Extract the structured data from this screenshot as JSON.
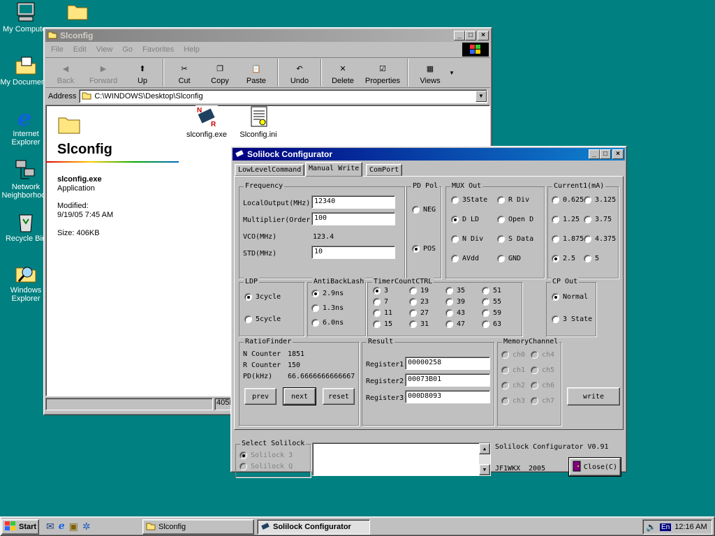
{
  "desktop": {
    "icons": [
      "My Computer",
      "",
      "My Documents",
      "Internet Explorer",
      "Network Neighborhood",
      "Recycle Bin",
      "Windows Explorer"
    ]
  },
  "explorer": {
    "title": "Slconfig",
    "menu": [
      "File",
      "Edit",
      "View",
      "Go",
      "Favorites",
      "Help"
    ],
    "toolbar": [
      "Back",
      "Forward",
      "Up",
      "Cut",
      "Copy",
      "Paste",
      "Undo",
      "Delete",
      "Properties",
      "Views"
    ],
    "address_label": "Address",
    "address_value": "C:\\WINDOWS\\Desktop\\Slconfig",
    "folder_heading": "Slconfig",
    "files": [
      "slconfig.exe",
      "Slconfig.ini"
    ],
    "info": {
      "name": "slconfig.exe",
      "type": "Application",
      "modified_label": "Modified:",
      "modified": "9/19/05 7:45 AM",
      "size": "Size: 406KB"
    },
    "status_size": "405K"
  },
  "config": {
    "title": "Solilock Configurator",
    "tabs": [
      "LowLevelCommand",
      "Manual Write",
      "ComPort"
    ],
    "frequency": {
      "label": "Frequency",
      "local_output_label": "LocalOutput(MHz)",
      "local_output": "12340",
      "multiplier_label": "Multiplier(Order)",
      "multiplier": "100",
      "vco_label": "VCO(MHz)",
      "vco": "123.4",
      "std_label": "STD(MHz)",
      "std": "10"
    },
    "pd_pol": {
      "label": "PD Pol",
      "options": [
        "NEG",
        "POS"
      ],
      "selected": 1
    },
    "mux_out": {
      "label": "MUX Out",
      "options": [
        "3State",
        "R Div",
        "D LD",
        "Open D",
        "N Div",
        "S Data",
        "AVdd",
        "GND"
      ],
      "selected": 2
    },
    "current1": {
      "label": "Current1(mA)",
      "options": [
        "0.625",
        "3.125",
        "1.25",
        "3.75",
        "1.875",
        "4.375",
        "2.5",
        "5"
      ],
      "selected": 6
    },
    "ldp": {
      "label": "LDP",
      "options": [
        "3cycle",
        "5cycle"
      ],
      "selected": 0
    },
    "antibacklash": {
      "label": "AntiBackLash",
      "options": [
        "2.9ns",
        "1.3ns",
        "6.0ns"
      ],
      "selected": 0
    },
    "timer": {
      "label": "TimerCountCTRL",
      "options": [
        "3",
        "19",
        "35",
        "51",
        "7",
        "23",
        "39",
        "55",
        "11",
        "27",
        "43",
        "59",
        "15",
        "31",
        "47",
        "63"
      ],
      "selected": 0
    },
    "cp_out": {
      "label": "CP Out",
      "options": [
        "Normal",
        "3 State"
      ],
      "selected": 0
    },
    "ratio": {
      "label": "RatioFinder",
      "n_label": "N Counter",
      "n": "1851",
      "r_label": "R Counter",
      "r": "150",
      "pd_label": "PD(kHz)",
      "pd": "66.6666666666667",
      "prev": "prev",
      "next": "next",
      "reset": "reset"
    },
    "result": {
      "label": "Result",
      "registers": [
        {
          "label": "Register1",
          "value": "00000258"
        },
        {
          "label": "Register2",
          "value": "00073B01"
        },
        {
          "label": "Register3",
          "value": "000D8093"
        }
      ]
    },
    "memory": {
      "label": "MemoryChannel",
      "options": [
        "ch0",
        "ch4",
        "ch1",
        "ch5",
        "ch2",
        "ch6",
        "ch3",
        "ch7"
      ]
    },
    "write": "write",
    "select": {
      "label": "Select Solilock",
      "options": [
        "Solilock 3",
        "Solilock Q"
      ]
    },
    "version": "Solilock Configurator V0.91",
    "author": "JF1WKX",
    "year": "2005",
    "close": "Close(C)"
  },
  "taskbar": {
    "start": "Start",
    "tasks": [
      "Slconfig",
      "Solilock Configurator"
    ],
    "lang": "En",
    "clock": "12:16 AM"
  }
}
